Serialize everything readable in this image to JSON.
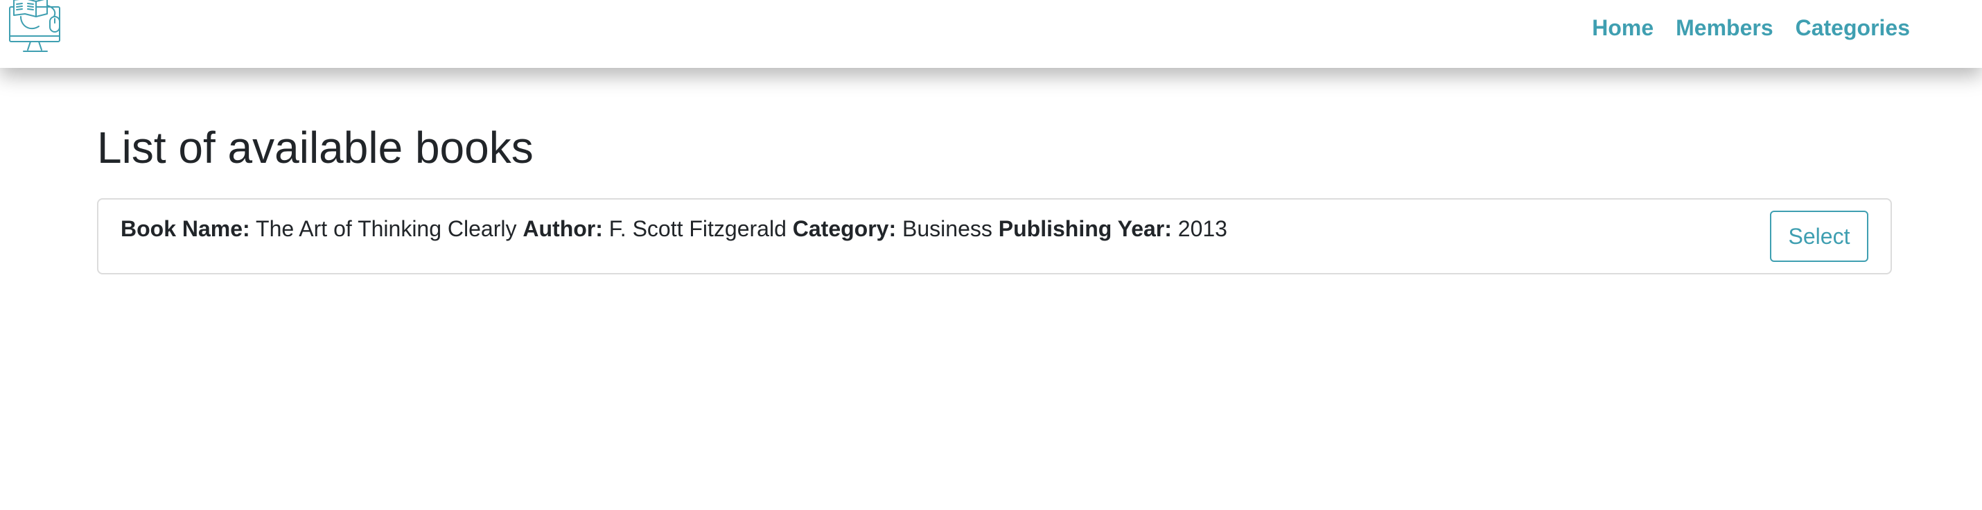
{
  "nav": {
    "links": [
      {
        "label": "Home"
      },
      {
        "label": "Members"
      },
      {
        "label": "Categories"
      }
    ]
  },
  "main": {
    "title": "List of available books",
    "books": [
      {
        "name_label": "Book Name:",
        "name": "The Art of Thinking Clearly",
        "author_label": "Author:",
        "author": "F. Scott Fitzgerald",
        "category_label": "Category:",
        "category": "Business",
        "year_label": "Publishing Year:",
        "year": "2013",
        "select_label": "Select"
      }
    ]
  },
  "icons": {
    "logo": "computer-book-mouse-icon"
  },
  "colors": {
    "accent": "#3f9fb1",
    "text": "#212529",
    "border": "#dcdcdc"
  }
}
